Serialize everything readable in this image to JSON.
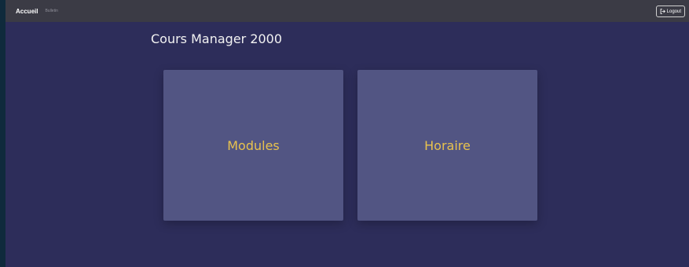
{
  "navbar": {
    "brand": "Accueil",
    "links": [
      "Bulletin"
    ],
    "logout_label": "Logout"
  },
  "page": {
    "title": "Cours Manager 2000"
  },
  "cards": [
    {
      "label": "Modules"
    },
    {
      "label": "Horaire"
    }
  ],
  "colors": {
    "background": "#2d2d5a",
    "navbar": "#3b3b45",
    "card": "#525583",
    "card_text": "#e8c24e"
  }
}
